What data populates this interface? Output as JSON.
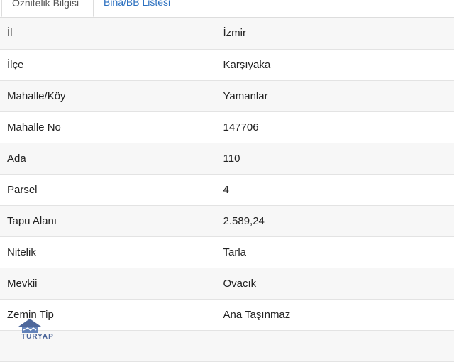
{
  "tabs": {
    "active_label": "Öznitelik Bilgisi",
    "second_label": "Bina/BB Listesi"
  },
  "rows": [
    {
      "label": "İl",
      "value": "İzmir"
    },
    {
      "label": "İlçe",
      "value": "Karşıyaka"
    },
    {
      "label": "Mahalle/Köy",
      "value": "Yamanlar"
    },
    {
      "label": "Mahalle No",
      "value": "147706"
    },
    {
      "label": "Ada",
      "value": "110"
    },
    {
      "label": "Parsel",
      "value": "4"
    },
    {
      "label": "Tapu Alanı",
      "value": "2.589,24"
    },
    {
      "label": "Nitelik",
      "value": "Tarla"
    },
    {
      "label": "Mevkii",
      "value": "Ovacık"
    },
    {
      "label": "Zemin Tip",
      "value": "Ana Taşınmaz"
    },
    {
      "label": "",
      "value": ""
    }
  ],
  "watermark": {
    "icon": "house-handshake-icon",
    "text": "TURYAP",
    "color": "#2f4d8a"
  }
}
